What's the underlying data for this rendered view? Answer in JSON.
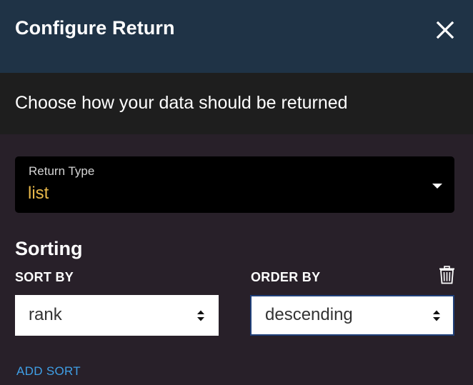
{
  "dialog": {
    "title": "Configure Return",
    "subtitle": "Choose how your data should be returned"
  },
  "return_type": {
    "label": "Return Type",
    "value": "list"
  },
  "sorting": {
    "title": "Sorting",
    "sort_by_label": "SORT BY",
    "order_by_label": "ORDER BY",
    "sort_by_value": "rank",
    "order_by_value": "descending",
    "add_sort_label": "ADD SORT"
  },
  "icons": {
    "close": "close-icon",
    "dropdown": "caret-down-icon",
    "delete": "trash-icon",
    "select": "up-down-arrows-icon"
  },
  "colors": {
    "header_bg": "#1f3346",
    "subheader_bg": "#1e1e1e",
    "body_bg": "#282029",
    "accent_value": "#e8b84a",
    "link": "#3f9fe6"
  }
}
